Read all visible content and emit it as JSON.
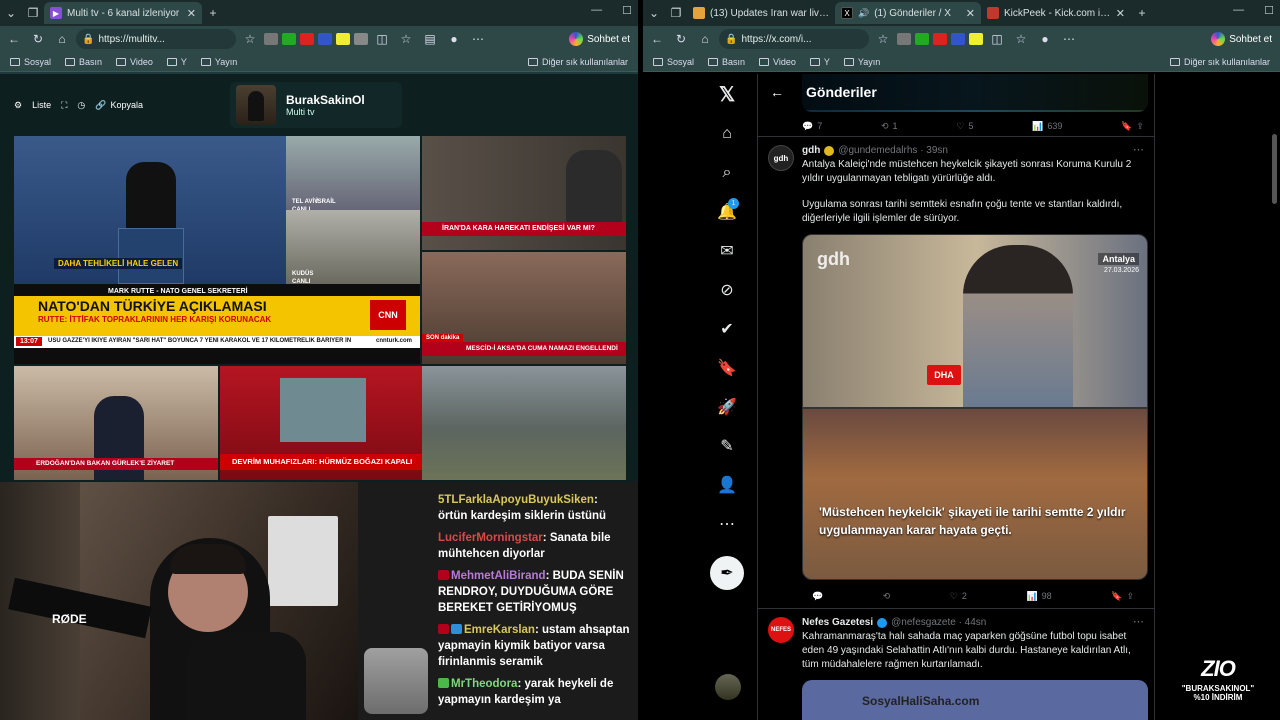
{
  "left_window": {
    "tab_title": "Multi tv - 6 kanal izleniyor",
    "url": "https://multitv...",
    "chat_button": "Sohbet et",
    "bookmarks": [
      "Sosyal",
      "Basın",
      "Video",
      "Y",
      "Yayın"
    ],
    "bookmarks_other": "Diğer sık kullanılanlar"
  },
  "multitv": {
    "tools": {
      "list": "Liste",
      "copy": "Kopyala"
    },
    "channel_name": "BurakSakinOl",
    "channel_sub": "Multi tv",
    "news": {
      "lower_third_1": "DAHA TEHLİKELİ HALE GELEN",
      "speaker": "MARK RUTTE - NATO GENEL SEKRETERİ",
      "headline": "NATO'DAN TÜRKİYE AÇIKLAMASI",
      "subline": "RUTTE: İTTİFAK TOPRAKLARININ HER KARIŞI KORUNACAK",
      "ticker_time": "13:07",
      "ticker": "USU GAZZE'Yİ İKİYE AYIRAN \"SARI HAT\" BOYUNCA 7 YENİ KARAKOL VE 17 KİLOMETRELİK BARİYER İN",
      "cnn": "CNN TÜRK",
      "cnn_site": "cnnturk.com",
      "telaviv": "TEL AVİV",
      "israil": "İSRAİL",
      "canli": "CANLI",
      "kudus": "KUDÜS",
      "iran_banner": "İRAN'DA KARA HAREKATI ENDİŞESİ VAR MI?",
      "son_dakika": "SON dakika",
      "mescid": "MESCİD-İ AKSA'DA CUMA NAMAZI ENGELLENDİ",
      "bakan": "ERDOĞAN'DAN BAKAN GÜRLEK'E ZİYARET",
      "devrim": "DEVRİM MUHAFIZLARI: HÜRMÜZ BOĞAZI KAPALI"
    },
    "chat": [
      {
        "user": "5TLFarklaApoyuBuyukSiken",
        "msg": "örtün kardeşim siklerin üstünü"
      },
      {
        "user": "LuciferMorningstar",
        "msg": "Sanata bile mühtehcen diyorlar"
      },
      {
        "user": "MehmetAliBirand",
        "msg": "BUDA SENİN RENDROY, DUYDUĞUMA GÖRE BEREKET GETİRİYOMUŞ"
      },
      {
        "user": "EmreKarslan",
        "msg": "ustam ahsaptan yapmayin kiymik batiyor varsa firinlanmis seramik"
      },
      {
        "user": "MrTheodora",
        "msg": "yarak heykeli de yapmayın kardeşim ya"
      }
    ],
    "mic_label": "RØDE"
  },
  "right_window": {
    "tabs": [
      {
        "title": "(13) Updates Iran war live: Tru",
        "color": "#e6a23c"
      },
      {
        "title": "(1) Gönderiler / X",
        "color": "#000000"
      },
      {
        "title": "KickPeek - Kick.com için Gerçe",
        "color": "#c0392b"
      }
    ],
    "url": "https://x.com/i...",
    "chat_button": "Sohbet et",
    "bookmarks": [
      "Sosyal",
      "Basın",
      "Video",
      "Y",
      "Yayın"
    ],
    "bookmarks_other": "Diğer sık kullanılanlar"
  },
  "x": {
    "page_title": "Gönderiler",
    "notif_count": "1",
    "prev_actions": {
      "replies": "7",
      "reposts": "1",
      "likes": "5",
      "views": "639"
    },
    "post1": {
      "name": "gdh",
      "handle": "@gundemedalrhs · 39sn",
      "avatar": "gdh",
      "text1": "Antalya Kaleiçi'nde müstehcen heykelcik şikayeti sonrası Koruma Kurulu 2 yıldır uygulanmayan tebligatı yürürlüğe aldı.",
      "text2": "Uygulama sonrası tarihi semtteki esnafın çoğu tente ve stantları kaldırdı, diğerleriyle ilgili işlemler de sürüyor.",
      "img_logo": "gdh",
      "img_city": "Antalya",
      "img_date": "27.03.2026",
      "img_dha": "DHA",
      "caption": "'Müstehcen heykelcik' şikayeti ile tarihi semtte 2 yıldır uygulanmayan karar hayata geçti.",
      "actions": {
        "replies": "",
        "reposts": "",
        "likes": "2",
        "views": "98"
      }
    },
    "post2": {
      "name": "Nefes Gazetesi",
      "handle": "@nefesgazete · 44sn",
      "avatar": "NEFES",
      "text": "Kahramanmaraş'ta halı sahada maç yaparken göğsüne futbol topu isabet eden 49 yaşındaki Selahattin Atlı'nın kalbi durdu. Hastaneye kaldırılan Atlı, tüm müdahalelere rağmen kurtarılamadı.",
      "img_text": "SosyalHaliSaha.com"
    }
  },
  "overlay": {
    "logo": "ZIO",
    "line1": "\"BURAKSAKINOL\"",
    "line2": "%10 İNDİRİM"
  }
}
